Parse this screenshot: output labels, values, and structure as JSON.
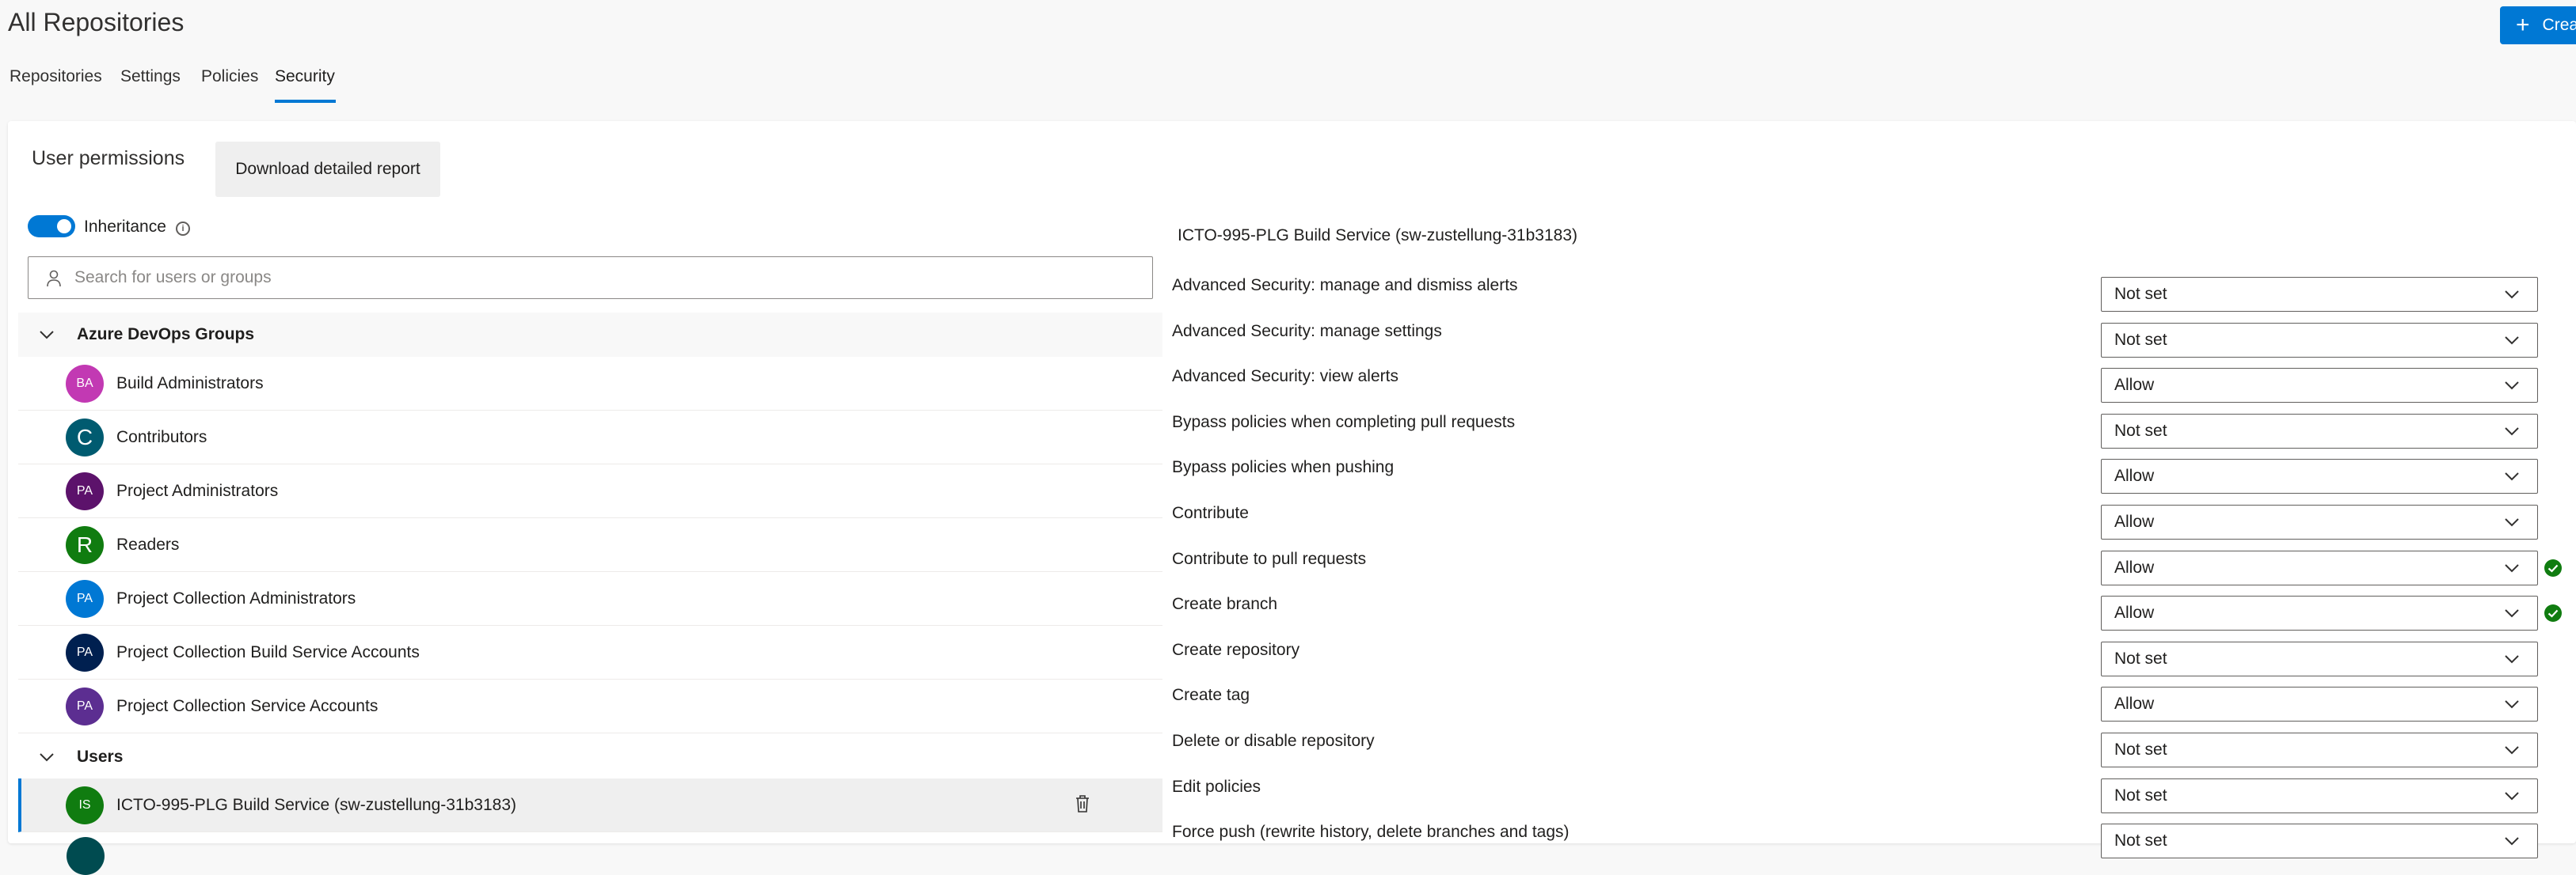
{
  "header": {
    "title": "All Repositories",
    "create_label": "Crea"
  },
  "tabs": [
    {
      "label": "Repositories"
    },
    {
      "label": "Settings"
    },
    {
      "label": "Policies"
    },
    {
      "label": "Security"
    }
  ],
  "left": {
    "heading": "User permissions",
    "download_label": "Download detailed report",
    "inheritance_label": "Inheritance",
    "info_glyph": "i",
    "search_placeholder": "Search for users or groups",
    "groups_header": "Azure DevOps Groups",
    "groups": [
      {
        "initials": "BA",
        "name": "Build Administrators",
        "color": "#c239b3"
      },
      {
        "initials": "C",
        "name": "Contributors",
        "color": "#005b70"
      },
      {
        "initials": "PA",
        "name": "Project Administrators",
        "color": "#5c126b"
      },
      {
        "initials": "R",
        "name": "Readers",
        "color": "#107c10"
      },
      {
        "initials": "PA",
        "name": "Project Collection Administrators",
        "color": "#0078d4"
      },
      {
        "initials": "PA",
        "name": "Project Collection Build Service Accounts",
        "color": "#002050"
      },
      {
        "initials": "PA",
        "name": "Project Collection Service Accounts",
        "color": "#5c2e91"
      }
    ],
    "users_header": "Users",
    "users": [
      {
        "initials": "IS",
        "name": "ICTO-995-PLG Build Service (sw-zustellung-31b3183)",
        "color": "#107c10"
      }
    ]
  },
  "right": {
    "identity_title": "ICTO-995-PLG Build Service (sw-zustellung-31b3183)",
    "permissions": [
      {
        "label": "Advanced Security: manage and dismiss alerts",
        "value": "Not set"
      },
      {
        "label": "Advanced Security: manage settings",
        "value": "Not set"
      },
      {
        "label": "Advanced Security: view alerts",
        "value": "Allow"
      },
      {
        "label": "Bypass policies when completing pull requests",
        "value": "Not set"
      },
      {
        "label": "Bypass policies when pushing",
        "value": "Allow"
      },
      {
        "label": "Contribute",
        "value": "Allow"
      },
      {
        "label": "Contribute to pull requests",
        "value": "Allow"
      },
      {
        "label": "Create branch",
        "value": "Allow"
      },
      {
        "label": "Create repository",
        "value": "Not set"
      },
      {
        "label": "Create tag",
        "value": "Allow"
      },
      {
        "label": "Delete or disable repository",
        "value": "Not set"
      },
      {
        "label": "Edit policies",
        "value": "Not set"
      },
      {
        "label": "Force push (rewrite history, delete branches and tags)",
        "value": "Not set"
      }
    ]
  },
  "colors": {
    "accent": "#0078d4",
    "success": "#107c10"
  }
}
